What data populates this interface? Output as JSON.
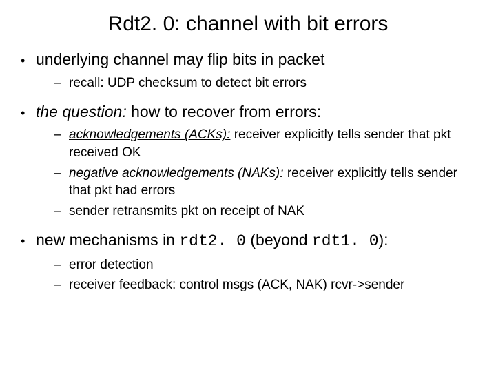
{
  "title": "Rdt2. 0: channel with bit errors",
  "bullets": [
    {
      "text": "underlying channel may flip bits in packet",
      "sub": [
        {
          "plain": "recall: UDP checksum to detect bit errors"
        }
      ]
    },
    {
      "emph": "the question:",
      "rest": " how to recover from errors:",
      "sub": [
        {
          "term": "acknowledgements (ACKs):",
          "rest": " receiver explicitly tells sender that pkt received OK"
        },
        {
          "term": "negative acknowledgements (NAKs):",
          "rest": " receiver explicitly tells sender that pkt had errors"
        },
        {
          "plain": "sender retransmits pkt on receipt of NAK"
        }
      ]
    },
    {
      "pre": "new mechanisms in ",
      "code1": "rdt2. 0",
      "mid": " (beyond ",
      "code2": "rdt1. 0",
      "post": "):",
      "sub": [
        {
          "plain": "error detection"
        },
        {
          "plain": "receiver feedback: control msgs (ACK, NAK) rcvr->sender"
        }
      ]
    }
  ]
}
